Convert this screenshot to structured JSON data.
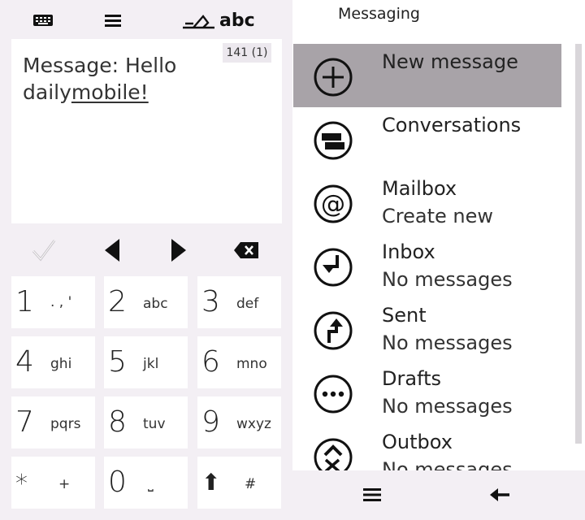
{
  "keypad_screen": {
    "counter": "141 (1)",
    "message_text": "Message: Hello daily",
    "message_underlined": "mobile!",
    "input_mode_label": "abc",
    "keys": [
      {
        "num": "1",
        "letters": ". , '"
      },
      {
        "num": "2",
        "letters": "abc"
      },
      {
        "num": "3",
        "letters": "def"
      },
      {
        "num": "4",
        "letters": "ghi"
      },
      {
        "num": "5",
        "letters": "jkl"
      },
      {
        "num": "6",
        "letters": "mno"
      },
      {
        "num": "7",
        "letters": "pqrs"
      },
      {
        "num": "8",
        "letters": "tuv"
      },
      {
        "num": "9",
        "letters": "wxyz"
      },
      {
        "num": "*",
        "letters": "+"
      },
      {
        "num": "0",
        "letters": "⎵"
      },
      {
        "num": "⬆",
        "letters": "#"
      }
    ]
  },
  "messaging": {
    "title": "Messaging",
    "items": [
      {
        "title": "New message",
        "subtitle": "",
        "icon": "plus-circle-icon",
        "selected": true
      },
      {
        "title": "Conversations",
        "subtitle": "",
        "icon": "conversations-icon",
        "selected": false
      },
      {
        "title": "Mailbox",
        "subtitle": "Create new",
        "icon": "at-icon",
        "selected": false
      },
      {
        "title": "Inbox",
        "subtitle": "No messages",
        "icon": "inbox-arrow-icon",
        "selected": false
      },
      {
        "title": "Sent",
        "subtitle": "No messages",
        "icon": "sent-arrow-icon",
        "selected": false
      },
      {
        "title": "Drafts",
        "subtitle": "No messages",
        "icon": "drafts-dots-icon",
        "selected": false
      },
      {
        "title": "Outbox",
        "subtitle": "No messages",
        "icon": "outbox-icon",
        "selected": false
      }
    ]
  },
  "colors": {
    "panel_bg": "#f3eff4",
    "selected_bg": "#a8a3a8",
    "key_bg": "#ffffff"
  }
}
